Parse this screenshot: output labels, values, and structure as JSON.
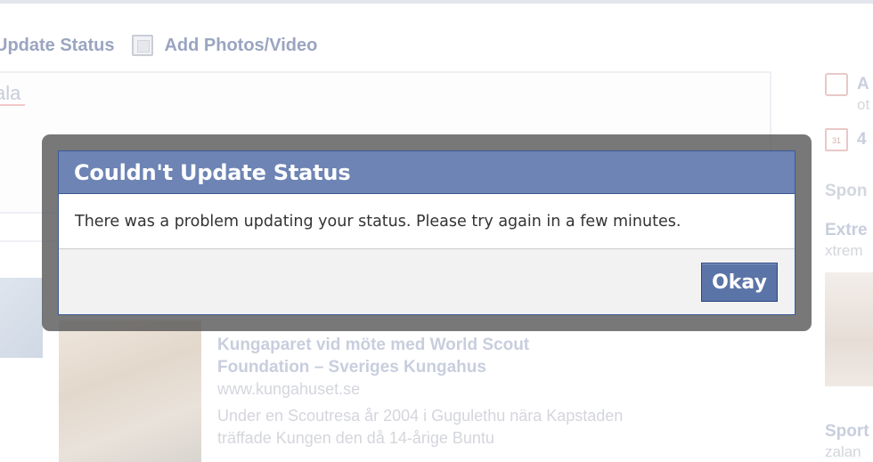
{
  "background": {
    "composer": {
      "update_status_label": "Update Status",
      "add_photos_label": "Add Photos/Video",
      "status_text": "ala"
    },
    "story": {
      "title": "Kungaparet vid möte med World Scout Foundation – Sveriges Kungahus",
      "url": "www.kungahuset.se",
      "snippet": "Under en Scoutresa år 2004 i Gugulethu nära Kapstaden träffade Kungen den då 14-årige Buntu"
    },
    "right_column": {
      "gift_title": "A",
      "gift_sub": "ot",
      "calendar_icon_text": "31",
      "calendar_text": "4",
      "sponsored": "Spon",
      "ad1_title": "Extre",
      "ad1_sub": "xtrem",
      "ad2_title": "Sport",
      "ad2_sub": "zalan"
    }
  },
  "dialog": {
    "title": "Couldn't Update Status",
    "message": "There was a problem updating your status. Please try again in a few minutes.",
    "okay_label": "Okay"
  },
  "colors": {
    "header_bg": "#6d84b4",
    "header_border": "#3b5998",
    "button_bg": "#5b74a8",
    "footer_bg": "#f2f2f2",
    "overlay_frame": "#525252"
  }
}
